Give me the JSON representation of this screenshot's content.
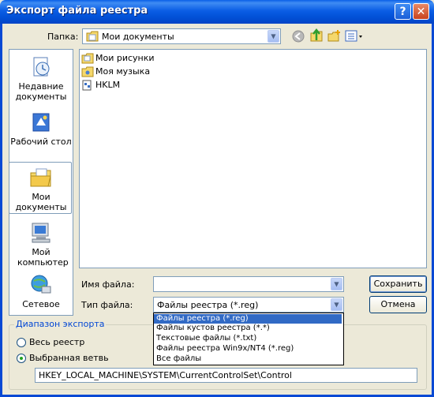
{
  "window": {
    "title": "Экспорт файла реестра",
    "help_label": "?",
    "close_label": "✕"
  },
  "lookin": {
    "label": "Папка:",
    "value": "Мои документы"
  },
  "places": [
    {
      "label": "Недавние документы",
      "icon": "recent-documents-icon"
    },
    {
      "label": "Рабочий стол",
      "icon": "desktop-icon"
    },
    {
      "label": "Мои документы",
      "icon": "my-documents-icon"
    },
    {
      "label": "Мой компьютер",
      "icon": "my-computer-icon"
    },
    {
      "label": "Сетевое",
      "icon": "network-icon"
    }
  ],
  "files": [
    {
      "name": "Мои рисунки",
      "icon": "folder-icon"
    },
    {
      "name": "Моя музыка",
      "icon": "folder-icon"
    },
    {
      "name": "HKLM",
      "icon": "registry-file-icon"
    }
  ],
  "filename": {
    "label": "Имя файла:",
    "value": ""
  },
  "filetype": {
    "label": "Тип файла:",
    "value": "Файлы реестра (*.reg)",
    "options": [
      "Файлы реестра (*.reg)",
      "Файлы кустов реестра (*.*)",
      "Текстовые файлы (*.txt)",
      "Файлы реестра Win9x/NT4 (*.reg)",
      "Все файлы"
    ]
  },
  "buttons": {
    "save": "Сохранить",
    "cancel": "Отмена"
  },
  "export_range": {
    "title": "Диапазон экспорта",
    "all_label": "Весь реестр",
    "branch_label": "Выбранная ветвь",
    "branch_value": "HKEY_LOCAL_MACHINE\\SYSTEM\\CurrentControlSet\\Control"
  },
  "colors": {
    "title_bar": "#0a5fe8",
    "selection": "#316ac5",
    "group_label": "#0046d5"
  }
}
